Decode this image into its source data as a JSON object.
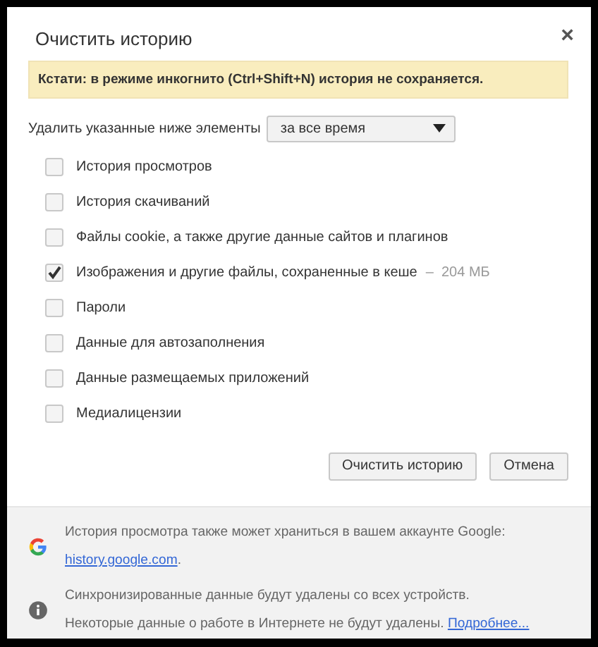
{
  "dialog": {
    "title": "Очистить историю",
    "close": "×"
  },
  "notice": "Кстати: в режиме инкогнито (Ctrl+Shift+N) история не сохраняется.",
  "period": {
    "label": "Удалить указанные ниже элементы",
    "value": "за все время"
  },
  "items": [
    {
      "label": "История просмотров",
      "checked": false
    },
    {
      "label": "История скачиваний",
      "checked": false
    },
    {
      "label": "Файлы cookie, а также другие данные сайтов и плагинов",
      "checked": false
    },
    {
      "label": "Изображения и другие файлы, сохраненные в кеше",
      "checked": true,
      "size": "–  204 МБ"
    },
    {
      "label": "Пароли",
      "checked": false
    },
    {
      "label": "Данные для автозаполнения",
      "checked": false
    },
    {
      "label": "Данные размещаемых приложений",
      "checked": false
    },
    {
      "label": "Медиалицензии",
      "checked": false
    }
  ],
  "buttons": [
    "Очистить историю",
    "Отмена"
  ],
  "footer": [
    {
      "kind": "google",
      "text": "История просмотра также может храниться в вашем аккаунте Google: ",
      "link": "history.google.com",
      "after": "."
    },
    {
      "kind": "info",
      "text": "Синхронизированные данные будут удалены со всех устройств. Некоторые данные о работе в Интернете не будут удалены. ",
      "link": "Подробнее..."
    }
  ]
}
